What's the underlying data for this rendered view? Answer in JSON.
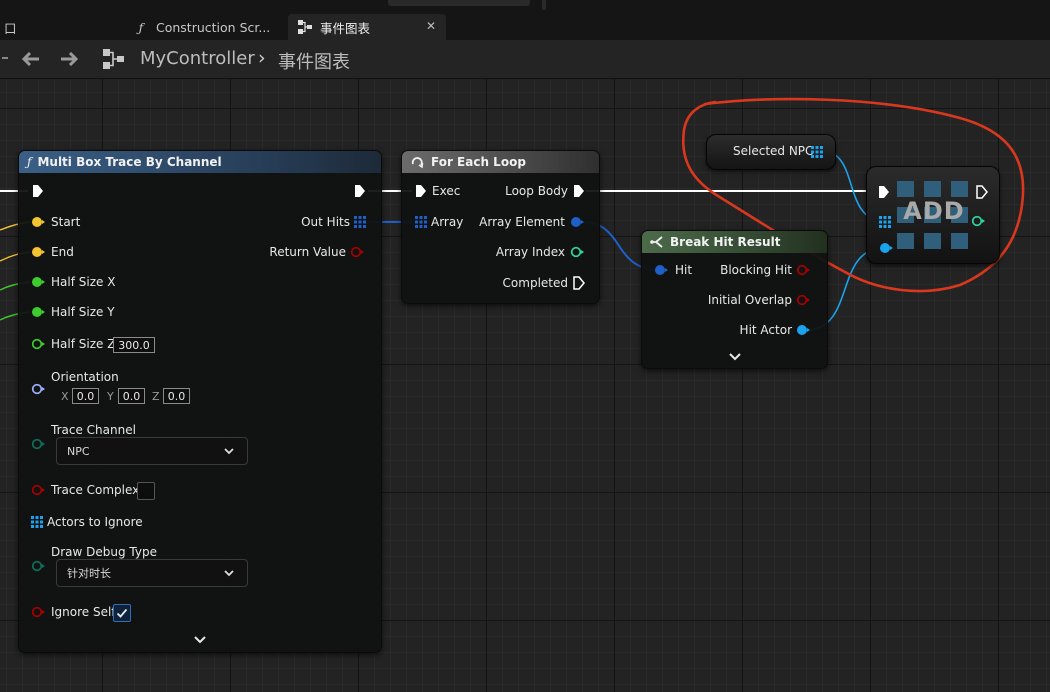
{
  "tabs": [
    {
      "label": "口"
    },
    {
      "label": "Construction Scr...",
      "icon": "function-icon"
    },
    {
      "label": "事件图表",
      "icon": "event-graph-icon",
      "active": true
    }
  ],
  "breadcrumb": {
    "root": "MyController",
    "current": "事件图表"
  },
  "nodes": {
    "multi_box_trace": {
      "title": "Multi Box Trace By Channel",
      "header_color": "#3a5f86",
      "inputs": {
        "start": "Start",
        "end": "End",
        "half_size_x": "Half Size X",
        "half_size_y": "Half Size Y",
        "half_size_z": "Half Size Z",
        "half_size_z_value": "300.0",
        "orientation": "Orientation",
        "orientation_x_label": "X",
        "orientation_x": "0.0",
        "orientation_y_label": "Y",
        "orientation_y": "0.0",
        "orientation_z_label": "Z",
        "orientation_z": "0.0",
        "trace_channel": "Trace Channel",
        "trace_channel_value": "NPC",
        "trace_complex": "Trace Complex",
        "actors_to_ignore": "Actors to Ignore",
        "draw_debug_type": "Draw Debug Type",
        "draw_debug_type_value": "针对时长",
        "ignore_self": "Ignore Self"
      },
      "outputs": {
        "out_hits": "Out Hits",
        "return_value": "Return Value"
      },
      "trace_complex_checked": false,
      "ignore_self_checked": true
    },
    "for_each_loop": {
      "title": "For Each Loop",
      "header_color": "#6b6b6b",
      "inputs": {
        "exec": "Exec",
        "array": "Array"
      },
      "outputs": {
        "loop_body": "Loop Body",
        "array_element": "Array Element",
        "array_index": "Array Index",
        "completed": "Completed"
      }
    },
    "break_hit_result": {
      "title": "Break Hit Result",
      "header_color": "#4c6b4a",
      "inputs": {
        "hit": "Hit"
      },
      "outputs": {
        "blocking_hit": "Blocking Hit",
        "initial_overlap": "Initial Overlap",
        "hit_actor": "Hit Actor"
      }
    },
    "selected_npc": {
      "label": "Selected NPC"
    },
    "add": {
      "title": "ADD"
    }
  },
  "colors": {
    "exec": "#ffffff",
    "vector": "#f5c431",
    "float": "#3fcb2e",
    "struct": "#1e5fc8",
    "object": "#1aa3ef",
    "bool": "#a80000",
    "int": "#2ed6a3",
    "rotator": "#9fb0ff",
    "annotation": "#d9381e"
  }
}
